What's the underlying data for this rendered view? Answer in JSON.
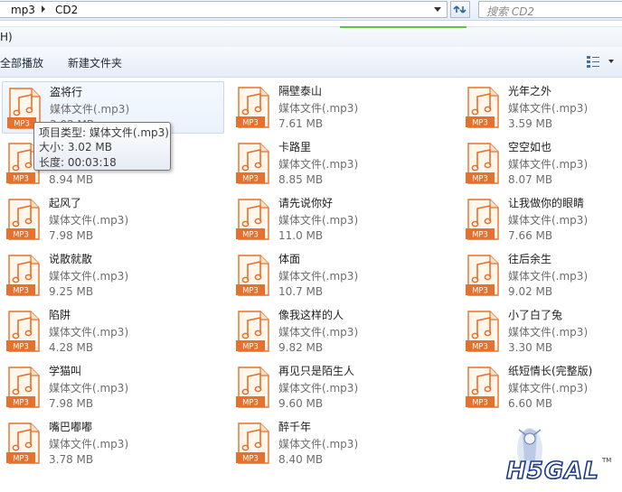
{
  "address_bar": {
    "breadcrumbs": [
      "mp3",
      "CD2"
    ],
    "search_placeholder": "搜索 CD2"
  },
  "menu": {
    "fragment": "H)"
  },
  "toolbar": {
    "play_all": "全部播放",
    "new_folder": "新建文件夹"
  },
  "files": [
    {
      "name": "盗将行",
      "type": "媒体文件(.mp3)",
      "size": "3.02 MB"
    },
    {
      "name": "隔壁泰山",
      "type": "媒体文件(.mp3)",
      "size": "7.61 MB"
    },
    {
      "name": "光年之外",
      "type": "媒体文件(.mp3)",
      "size": "3.59 MB"
    },
    {
      "name": "",
      "type": "",
      "size": "8.94 MB"
    },
    {
      "name": "卡路里",
      "type": "媒体文件(.mp3)",
      "size": "8.85 MB"
    },
    {
      "name": "空空如也",
      "type": "媒体文件(.mp3)",
      "size": "8.07 MB"
    },
    {
      "name": "起风了",
      "type": "媒体文件(.mp3)",
      "size": "7.98 MB"
    },
    {
      "name": "请先说你好",
      "type": "媒体文件(.mp3)",
      "size": "11.0 MB"
    },
    {
      "name": "让我做你的眼睛",
      "type": "媒体文件(.mp3)",
      "size": "7.66 MB"
    },
    {
      "name": "说散就散",
      "type": "媒体文件(.mp3)",
      "size": "9.25 MB"
    },
    {
      "name": "体面",
      "type": "媒体文件(.mp3)",
      "size": "10.7 MB"
    },
    {
      "name": "往后余生",
      "type": "媒体文件(.mp3)",
      "size": "9.02 MB"
    },
    {
      "name": "陷阱",
      "type": "媒体文件(.mp3)",
      "size": "4.28 MB"
    },
    {
      "name": "像我这样的人",
      "type": "媒体文件(.mp3)",
      "size": "9.82 MB"
    },
    {
      "name": "小了白了兔",
      "type": "媒体文件(.mp3)",
      "size": "3.30 MB"
    },
    {
      "name": "学猫叫",
      "type": "媒体文件(.mp3)",
      "size": "7.98 MB"
    },
    {
      "name": "再见只是陌生人",
      "type": "媒体文件(.mp3)",
      "size": "9.60 MB"
    },
    {
      "name": "纸短情长(完整版)",
      "type": "媒体文件(.mp3)",
      "size": "6.60 MB"
    },
    {
      "name": "嘴巴嘟嘟",
      "type": "媒体文件(.mp3)",
      "size": "3.78 MB"
    },
    {
      "name": "醉千年",
      "type": "媒体文件(.mp3)",
      "size": "8.40 MB"
    }
  ],
  "file_icon_label": "MP3",
  "tooltip": {
    "type_line": "项目类型: 媒体文件(.mp3)",
    "size_line": "大小: 3.02 MB",
    "duration_line": "长度: 00:03:18"
  },
  "watermark": {
    "text": "H5GAL",
    "tm": "TM"
  },
  "colors": {
    "icon_orange": "#e6702c",
    "icon_body": "#fff6ec",
    "selection": "#eaf2fc",
    "meta_text": "#6d6d6d"
  }
}
